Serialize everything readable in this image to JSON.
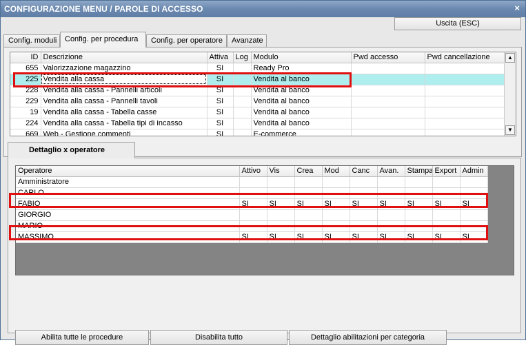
{
  "window": {
    "title": "CONFIGURAZIONE MENU / PAROLE DI ACCESSO",
    "close_glyph": "×"
  },
  "toolbar": {
    "exit_label": "Uscita (ESC)"
  },
  "tabs": [
    {
      "label": "Config. moduli"
    },
    {
      "label": "Config. per procedura",
      "active": true
    },
    {
      "label": "Config. per operatore"
    },
    {
      "label": "Avanzate"
    }
  ],
  "procedures": {
    "columns": [
      "ID",
      "Descrizione",
      "Attiva",
      "Log",
      "Modulo",
      "Pwd accesso",
      "Pwd cancellazione"
    ],
    "rows": [
      {
        "id": "655",
        "desc": "Valorizzazione magazzino",
        "attiva": "SI",
        "log": "",
        "modulo": "Ready Pro",
        "pwd": "",
        "pwdc": ""
      },
      {
        "id": "225",
        "desc": "Vendita alla cassa",
        "attiva": "SI",
        "log": "",
        "modulo": "Vendita al banco",
        "pwd": "",
        "pwdc": "",
        "selected": true
      },
      {
        "id": "228",
        "desc": "Vendita alla cassa - Pannelli articoli",
        "attiva": "SI",
        "log": "",
        "modulo": "Vendita al banco",
        "pwd": "",
        "pwdc": ""
      },
      {
        "id": "229",
        "desc": "Vendita alla cassa - Pannelli tavoli",
        "attiva": "SI",
        "log": "",
        "modulo": "Vendita al banco",
        "pwd": "",
        "pwdc": ""
      },
      {
        "id": "19",
        "desc": "Vendita alla cassa - Tabella casse",
        "attiva": "SI",
        "log": "",
        "modulo": "Vendita al banco",
        "pwd": "",
        "pwdc": ""
      },
      {
        "id": "224",
        "desc": "Vendita alla cassa - Tabella tipi di incasso",
        "attiva": "SI",
        "log": "",
        "modulo": "Vendita al banco",
        "pwd": "",
        "pwdc": ""
      },
      {
        "id": "669",
        "desc": "Web - Gestione commenti",
        "attiva": "SI",
        "log": "",
        "modulo": "E-commerce",
        "pwd": "",
        "pwdc": ""
      }
    ]
  },
  "detail": {
    "tab_label": "Dettaglio x operatore",
    "columns": [
      "Operatore",
      "Attivo",
      "Vis",
      "Crea",
      "Mod",
      "Canc",
      "Avan.",
      "Stampa",
      "Export",
      "Admin"
    ],
    "rows": [
      {
        "name": "Amministratore",
        "values": [
          "",
          "",
          "",
          "",
          "",
          "",
          "",
          "",
          ""
        ]
      },
      {
        "name": "CARLO",
        "values": [
          "",
          "",
          "",
          "",
          "",
          "",
          "",
          "",
          ""
        ]
      },
      {
        "name": "FABIO",
        "values": [
          "SI",
          "SI",
          "SI",
          "SI",
          "SI",
          "SI",
          "SI",
          "SI",
          "SI"
        ]
      },
      {
        "name": "GIORGIO",
        "values": [
          "",
          "",
          "",
          "",
          "",
          "",
          "",
          "",
          ""
        ]
      },
      {
        "name": "MARIO",
        "values": [
          "",
          "",
          "",
          "",
          "",
          "",
          "",
          "",
          ""
        ]
      },
      {
        "name": "MASSIMO",
        "values": [
          "SI",
          "SI",
          "SI",
          "SI",
          "SI",
          "SI",
          "SI",
          "SI",
          "SI"
        ]
      }
    ]
  },
  "footer": {
    "enable_all_label": "Abilita tutte le procedure",
    "disable_all_label": "Disabilita tutto",
    "detail_by_category_label": "Dettaglio abilitazioni per categoria"
  },
  "colors": {
    "selection": "#aeeeee",
    "highlight_box": "#e01010",
    "titlebar": "#6d8bb1"
  }
}
